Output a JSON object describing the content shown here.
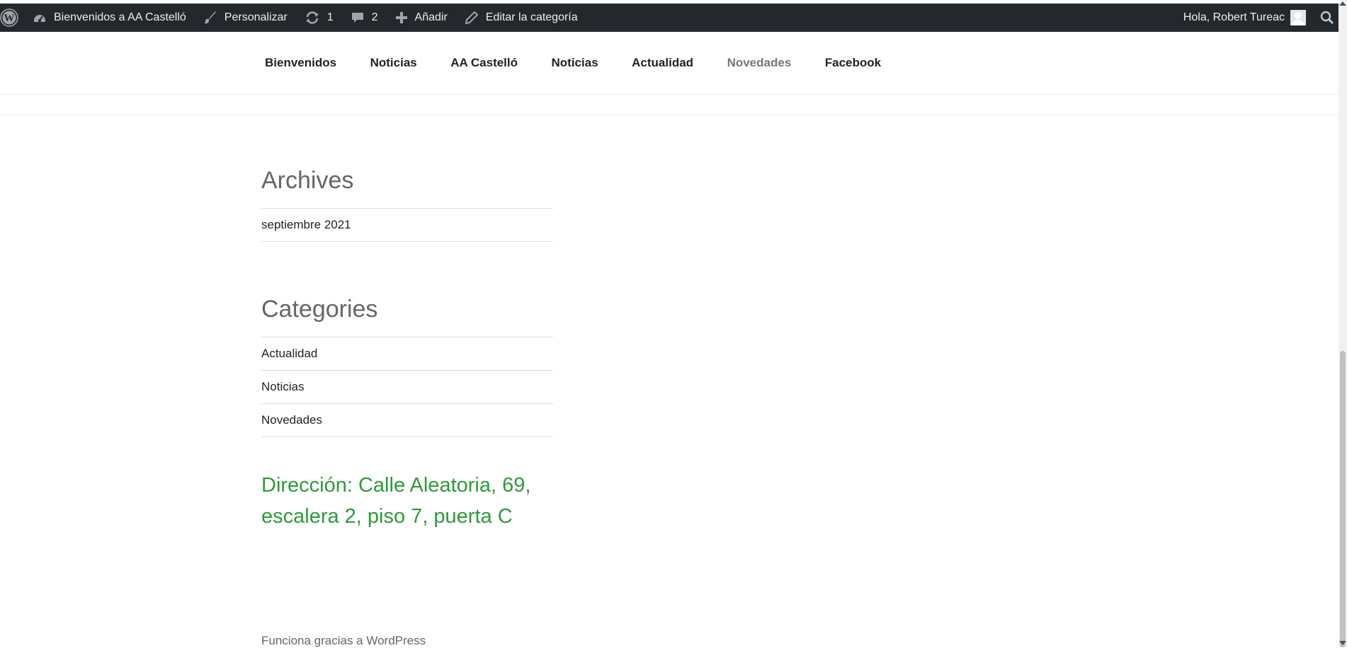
{
  "adminbar": {
    "site_name": "Bienvenidos a AA Castelló",
    "customize": "Personalizar",
    "updates_count": "1",
    "comments_count": "2",
    "add_new": "Añadir",
    "edit_category": "Editar la categoría",
    "greeting": "Hola, Robert Tureac"
  },
  "nav": {
    "items": [
      {
        "label": "Bienvenidos"
      },
      {
        "label": "Noticias"
      },
      {
        "label": "AA Castelló"
      },
      {
        "label": "Noticias"
      },
      {
        "label": "Actualidad"
      },
      {
        "label": "Novedades"
      },
      {
        "label": "Facebook"
      }
    ]
  },
  "archives": {
    "title": "Archives",
    "items": [
      "septiembre 2021"
    ]
  },
  "categories": {
    "title": "Categories",
    "items": [
      "Actualidad",
      "Noticias",
      "Novedades"
    ]
  },
  "address": "Dirección: Calle Aleatoria, 69, escalera 2, piso 7, puerta C",
  "footer": {
    "credit": "Funciona gracias a WordPress"
  },
  "colors": {
    "adminbar_bg": "#23282d",
    "address_green": "#2e9a3a",
    "current_nav": "#767676"
  }
}
